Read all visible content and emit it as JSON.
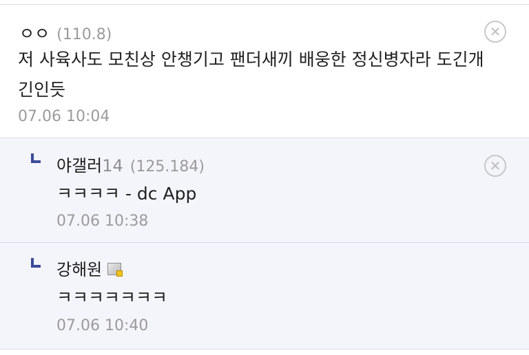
{
  "comments": [
    {
      "nick": "ㅇㅇ",
      "ip": "(110.8)",
      "text_line1": "저 사육사도 모친상 안챙기고 팬더새끼 배웅한 정신병자라 도긴개",
      "text_line2": "긴인듯",
      "date": "07.06 10:04",
      "delete_icon": "close-circle-icon"
    }
  ],
  "replies": [
    {
      "nick": "야갤러",
      "nick_suffix": "14",
      "ip": "(125.184)",
      "text": "ㅋㅋㅋㅋ - dc App",
      "date": "07.06 10:38",
      "delete_icon": "close-circle-icon"
    },
    {
      "nick": "강해원",
      "badge_icon": "gallog-icon",
      "text": "ㅋㅋㅋㅋㅋㅋㅋ",
      "date": "07.06 10:40"
    }
  ],
  "colors": {
    "reply_background": "#f4f5fb",
    "reply_mark": "#3b4a99",
    "divider": "#d9dbe6"
  }
}
